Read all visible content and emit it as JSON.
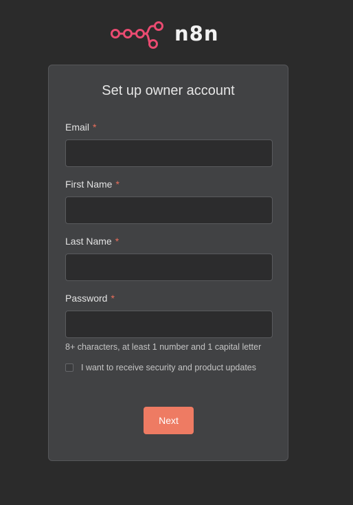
{
  "brand": {
    "name": "n8n",
    "logo_icon": "n8n-logo-icon",
    "logo_color": "#ea4b71"
  },
  "form": {
    "title": "Set up owner account",
    "required_marker": "*",
    "fields": [
      {
        "label": "Email",
        "value": "",
        "placeholder": ""
      },
      {
        "label": "First Name",
        "value": "",
        "placeholder": ""
      },
      {
        "label": "Last Name",
        "value": "",
        "placeholder": ""
      },
      {
        "label": "Password",
        "value": "",
        "placeholder": ""
      }
    ],
    "password_hint": "8+ characters, at least 1 number and 1 capital letter",
    "updates_checkbox": {
      "label": "I want to receive security and product updates",
      "checked": false
    },
    "submit_label": "Next"
  },
  "colors": {
    "background": "#2b2b2b",
    "card": "#414244",
    "input": "#2c2c2d",
    "accent": "#ee7b63",
    "required": "#ea6e5b"
  }
}
